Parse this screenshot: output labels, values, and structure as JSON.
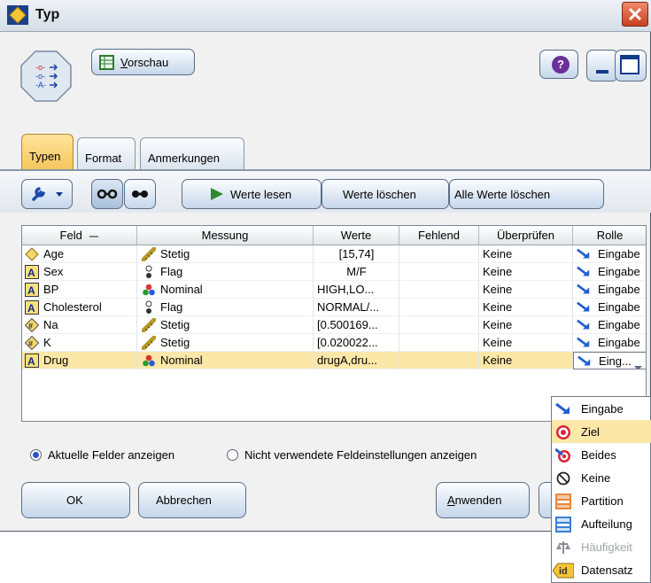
{
  "window": {
    "title": "Typ",
    "close_icon": "close-icon"
  },
  "header": {
    "preview_label_u": "V",
    "preview_label_rest": "orschau",
    "help_glyph": "?"
  },
  "tabs": [
    {
      "label": "Typen",
      "active": true
    },
    {
      "label": "Format",
      "active": false
    },
    {
      "label": "Anmerkungen",
      "active": false
    }
  ],
  "toolbar": {
    "read_values": "Werte lesen",
    "clear_values": "Werte löschen",
    "clear_all_values": "Alle Werte löschen"
  },
  "table": {
    "columns": [
      "Feld",
      "Messung",
      "Werte",
      "Fehlend",
      "Überprüfen",
      "Rolle"
    ],
    "rows": [
      {
        "field": "Age",
        "field_icon": "continuous-type-icon",
        "measure": "Stetig",
        "measure_icon": "ruler-icon",
        "values": "[15,74]",
        "missing": "",
        "check": "Keine",
        "role": "Eingabe"
      },
      {
        "field": "Sex",
        "field_icon": "string-type-icon",
        "measure": "Flag",
        "measure_icon": "flag-icon",
        "values": "M/F",
        "missing": "",
        "check": "Keine",
        "role": "Eingabe"
      },
      {
        "field": "BP",
        "field_icon": "string-type-icon",
        "measure": "Nominal",
        "measure_icon": "nominal-icon",
        "values": "HIGH,LO...",
        "missing": "",
        "check": "Keine",
        "role": "Eingabe"
      },
      {
        "field": "Cholesterol",
        "field_icon": "string-type-icon",
        "measure": "Flag",
        "measure_icon": "flag-icon",
        "values": "NORMAL/...",
        "missing": "",
        "check": "Keine",
        "role": "Eingabe"
      },
      {
        "field": "Na",
        "field_icon": "real-type-icon",
        "measure": "Stetig",
        "measure_icon": "ruler-icon",
        "values": "[0.500169...",
        "missing": "",
        "check": "Keine",
        "role": "Eingabe"
      },
      {
        "field": "K",
        "field_icon": "real-type-icon",
        "measure": "Stetig",
        "measure_icon": "ruler-icon",
        "values": "[0.020022...",
        "missing": "",
        "check": "Keine",
        "role": "Eingabe"
      },
      {
        "field": "Drug",
        "field_icon": "string-type-icon",
        "measure": "Nominal",
        "measure_icon": "nominal-icon",
        "values": "drugA,dru...",
        "missing": "",
        "check": "Keine",
        "role": "Eing..."
      }
    ]
  },
  "options": {
    "current_fields": "Aktuelle Felder anzeigen",
    "unused_settings": "Nicht verwendete Feldeinstellungen anzeigen"
  },
  "buttons": {
    "ok": "OK",
    "cancel": "Abbrechen",
    "apply_u": "A",
    "apply_rest": "nwenden"
  },
  "role_menu": [
    {
      "label": "Eingabe",
      "icon": "input-arrow-icon"
    },
    {
      "label": "Ziel",
      "icon": "target-icon"
    },
    {
      "label": "Beides",
      "icon": "both-icon"
    },
    {
      "label": "Keine",
      "icon": "none-icon"
    },
    {
      "label": "Partition",
      "icon": "partition-icon"
    },
    {
      "label": "Aufteilung",
      "icon": "split-icon"
    },
    {
      "label": "Häufigkeit",
      "icon": "frequency-icon"
    },
    {
      "label": "Datensatz",
      "icon": "record-id-icon",
      "badge": "id"
    }
  ],
  "colors": {
    "accent_tab": "#f5c55a",
    "selection": "#fbe7a8",
    "close": "#c8401e",
    "button_blue": "#c5d6ea"
  }
}
